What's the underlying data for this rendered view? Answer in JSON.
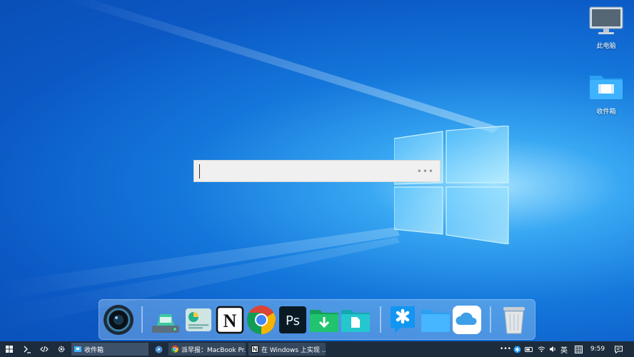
{
  "desktop": {
    "icons": [
      {
        "name": "this-pc-icon",
        "label": "此电脑"
      },
      {
        "name": "inbox-folder-icon",
        "label": "收件箱"
      }
    ]
  },
  "search": {
    "value": "",
    "placeholder": "",
    "more_label": "•••"
  },
  "dock": {
    "items": [
      "camera-lens-icon",
      "disk-drive-icon",
      "dashboard-app-icon",
      "notion-icon",
      "chrome-icon",
      "photoshop-icon",
      "downloads-folder-icon",
      "documents-folder-icon",
      "tencent-qq-icon",
      "folder-icon",
      "icloud-icon",
      "trash-icon"
    ],
    "notion_glyph": "N",
    "photoshop_glyph": "Ps"
  },
  "taskbar": {
    "tasks": [
      {
        "label": "收件箱"
      },
      {
        "label": "派早报：MacBook Pr..."
      },
      {
        "label": "在 Windows 上实现 ..."
      }
    ],
    "tray": {
      "more": "•••",
      "ime": "英",
      "time": "9:59"
    }
  },
  "colors": {
    "taskbar_bg": "#1d2c3d",
    "accent_blue": "#1a8cff",
    "search_bg": "#f0f0f0"
  }
}
